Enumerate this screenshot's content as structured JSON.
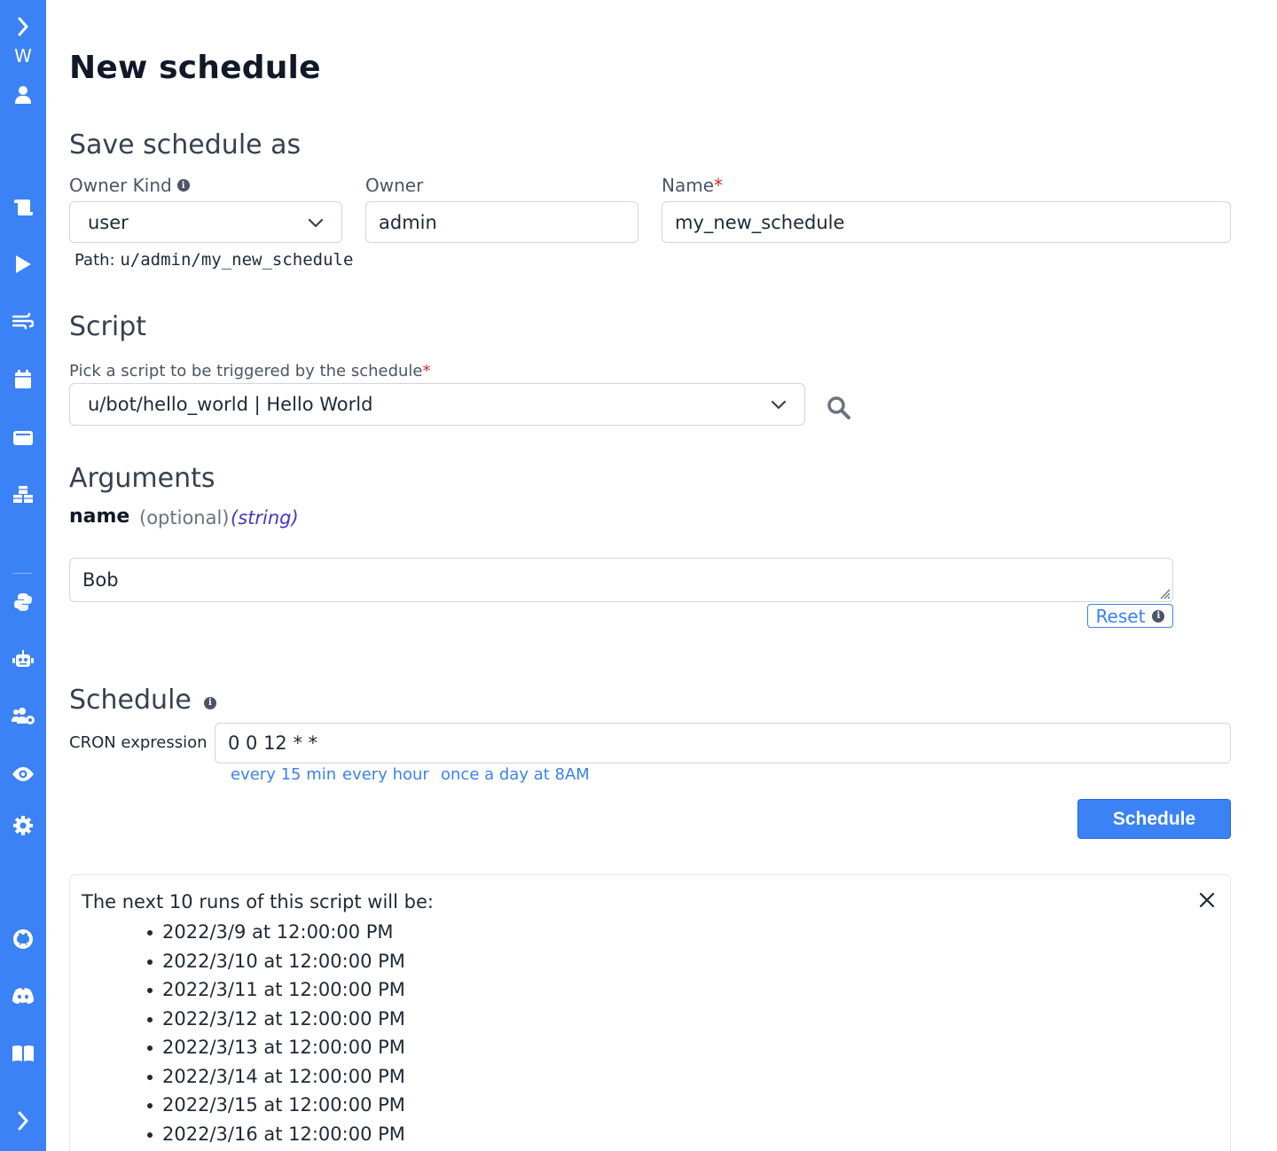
{
  "sidebar": {
    "brand_letter": "W",
    "items": [
      {
        "icon": "chevron-right-icon"
      },
      {
        "icon": "user-icon"
      },
      {
        "icon": "scroll-icon"
      },
      {
        "icon": "play-icon"
      },
      {
        "icon": "wind-icon"
      },
      {
        "icon": "calendar-icon"
      },
      {
        "icon": "wallet-icon"
      },
      {
        "icon": "cubes-icon"
      },
      {
        "icon": "python-icon"
      },
      {
        "icon": "robot-icon"
      },
      {
        "icon": "users-cog-icon"
      },
      {
        "icon": "eye-icon"
      },
      {
        "icon": "gear-icon"
      },
      {
        "icon": "github-icon"
      },
      {
        "icon": "discord-icon"
      },
      {
        "icon": "book-icon"
      },
      {
        "icon": "chevron-right-icon"
      }
    ]
  },
  "page": {
    "title": "New schedule"
  },
  "save_as": {
    "title": "Save schedule as",
    "owner_kind_label": "Owner Kind",
    "owner_kind_value": "user",
    "owner_label": "Owner",
    "owner_value": "admin",
    "name_label": "Name",
    "name_required": "*",
    "name_value": "my_new_schedule",
    "path_prefix": "Path:",
    "path_value": "u/admin/my_new_schedule"
  },
  "script": {
    "title": "Script",
    "pick_label": "Pick a script to be triggered by the schedule",
    "pick_required": "*",
    "selected": "u/bot/hello_world | Hello World"
  },
  "arguments": {
    "title": "Arguments",
    "arg_name": "name",
    "arg_optional": "(optional)",
    "arg_type": "(string)",
    "arg_value": "Bob",
    "reset_label": "Reset"
  },
  "schedule": {
    "title": "Schedule",
    "cron_label": "CRON expression",
    "cron_value": "0 0 12 * *",
    "presets": [
      "every 15 min",
      "every hour",
      "once a day at 8AM"
    ],
    "submit_label": "Schedule"
  },
  "next_runs": {
    "title": "The next 10 runs of this script will be:",
    "runs": [
      "2022/3/9 at 12:00:00 PM",
      "2022/3/10 at 12:00:00 PM",
      "2022/3/11 at 12:00:00 PM",
      "2022/3/12 at 12:00:00 PM",
      "2022/3/13 at 12:00:00 PM",
      "2022/3/14 at 12:00:00 PM",
      "2022/3/15 at 12:00:00 PM",
      "2022/3/16 at 12:00:00 PM"
    ]
  },
  "colors": {
    "sidebar": "#3b82f6",
    "accent": "#3b82f6",
    "required": "#dc2626",
    "type_hint": "#4338ca"
  }
}
